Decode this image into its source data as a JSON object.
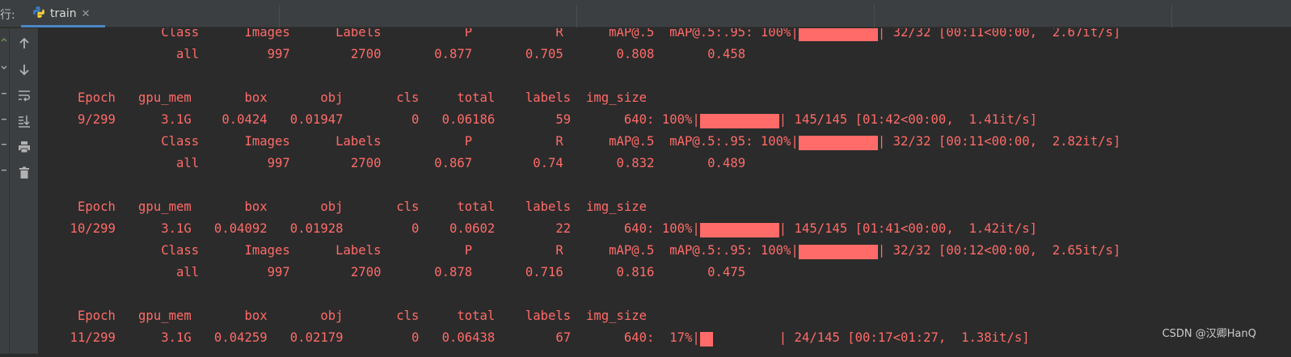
{
  "window": {
    "run_label": "行:",
    "tab_name": "train",
    "tab_close": "✕"
  },
  "toolbar": {
    "items": [
      {
        "icon": "arrow-up-icon"
      },
      {
        "icon": "arrow-down-icon"
      },
      {
        "icon": "soft-wrap-icon"
      },
      {
        "icon": "scroll-to-end-icon"
      },
      {
        "icon": "print-icon"
      },
      {
        "icon": "trash-icon"
      }
    ]
  },
  "console": {
    "lines": [
      {
        "pre": "                Class      Images      Labels           P           R      mAP@.5  mAP@.5:.95: 100%|",
        "bar": 10,
        "post": "| 32/32 [00:11<00:00,  2.67it/s]"
      },
      {
        "pre": "                  all         997        2700       0.877       0.705       0.808       0.458"
      },
      {
        "pre": ""
      },
      {
        "pre": "     Epoch   gpu_mem       box       obj       cls     total    labels  img_size"
      },
      {
        "pre": "     9/299      3.1G    0.0424   0.01947         0   0.06186        59       640: 100%|",
        "bar": 10,
        "post": "| 145/145 [01:42<00:00,  1.41it/s]"
      },
      {
        "pre": "                Class      Images      Labels           P           R      mAP@.5  mAP@.5:.95: 100%|",
        "bar": 10,
        "post": "| 32/32 [00:11<00:00,  2.82it/s]"
      },
      {
        "pre": "                  all         997        2700       0.867        0.74       0.832       0.489"
      },
      {
        "pre": ""
      },
      {
        "pre": "     Epoch   gpu_mem       box       obj       cls     total    labels  img_size"
      },
      {
        "pre": "    10/299      3.1G   0.04092   0.01928         0    0.0602        22       640: 100%|",
        "bar": 10,
        "post": "| 145/145 [01:41<00:00,  1.42it/s]"
      },
      {
        "pre": "                Class      Images      Labels           P           R      mAP@.5  mAP@.5:.95: 100%|",
        "bar": 10,
        "post": "| 32/32 [00:12<00:00,  2.65it/s]"
      },
      {
        "pre": "                  all         997        2700       0.878       0.716       0.816       0.475"
      },
      {
        "pre": ""
      },
      {
        "pre": "     Epoch   gpu_mem       box       obj       cls     total    labels  img_size"
      },
      {
        "pre": "    11/299      3.1G   0.04259   0.02179         0   0.06438        67       640:  17%|",
        "bar": 1.7,
        "post": "| 24/145 [00:17<01:27,  1.38it/s]"
      }
    ]
  },
  "watermark": "CSDN @汉卿HanQ",
  "colors": {
    "text": "#ff6b68",
    "background": "#2b2b2b",
    "panel": "#3c3f41",
    "tab_accent": "#4a88c7"
  }
}
